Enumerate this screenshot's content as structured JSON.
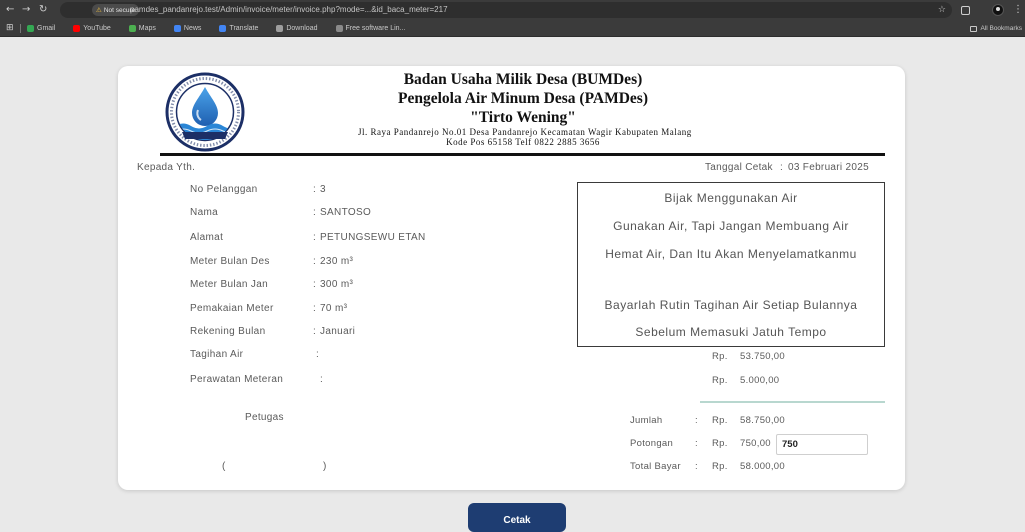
{
  "browser": {
    "security_label": "Not secure",
    "url": "pamdes_pandanrejo.test/Admin/invoice/meter/invoice.php?mode=...&id_baca_meter=217",
    "bookmarks": [
      {
        "label": "Gmail",
        "icon": "gmail-icon",
        "color": "#34a853"
      },
      {
        "label": "YouTube",
        "icon": "youtube-icon",
        "color": "#ff0000"
      },
      {
        "label": "Maps",
        "icon": "maps-icon",
        "color": "#4caf50"
      },
      {
        "label": "News",
        "icon": "news-icon",
        "color": "#4285f4"
      },
      {
        "label": "Translate",
        "icon": "translate-icon",
        "color": "#4285f4"
      },
      {
        "label": "Download",
        "icon": "download-icon",
        "color": "#9e9e9e"
      },
      {
        "label": "Free software Lin...",
        "icon": "page-icon",
        "color": "#8a8a8a"
      }
    ],
    "all_bookmarks_label": "All Bookmarks"
  },
  "header": {
    "line1": "Badan Usaha Milik Desa (BUMDes)",
    "line2": "Pengelola Air Minum Desa (PAMDes)",
    "line3": "\"Tirto Wening\"",
    "address": "Jl. Raya Pandanrejo No.01 Desa Pandanrejo Kecamatan Wagir Kabupaten Malang",
    "contact": "Kode Pos 65158 Telf 0822 2885 3656"
  },
  "receipt": {
    "recipient_label": "Kepada Yth.",
    "print_date_label": "Tanggal Cetak",
    "print_date": "03 Februari 2025",
    "separator": ":",
    "fields": [
      {
        "label": "No Pelanggan",
        "value": "3"
      },
      {
        "label": "Nama",
        "value": "SANTOSO"
      },
      {
        "label": "Alamat",
        "value": "PETUNGSEWU ETAN"
      },
      {
        "label": "Meter Bulan Des",
        "value": "230 m³"
      },
      {
        "label": "Meter Bulan Jan",
        "value": "300 m³"
      },
      {
        "label": "Pemakaian Meter",
        "value": "70 m³"
      },
      {
        "label": "Rekening Bulan",
        "value": "Januari"
      },
      {
        "label": "Tagihan Air"
      },
      {
        "label": "Perawatan Meteran"
      }
    ]
  },
  "message_box": {
    "lines": [
      "Bijak Menggunakan Air",
      "Gunakan Air, Tapi Jangan Membuang Air",
      "Hemat Air, Dan Itu Akan Menyelamatkanmu",
      "Bayarlah Rutin Tagihan Air Setiap Bulannya",
      "Sebelum Memasuki Jatuh Tempo"
    ]
  },
  "billing": {
    "currency": "Rp.",
    "tagihan_air": "53.750,00",
    "perawatan_meteran": "5.000,00",
    "jumlah_label": "Jumlah",
    "jumlah": "58.750,00",
    "potongan_label": "Potongan",
    "potongan": "750,00",
    "potongan_input": "750",
    "total_label": "Total Bayar",
    "total": "58.000,00"
  },
  "signature": {
    "label": "Petugas",
    "open": "(",
    "close": ")"
  },
  "print_button_label": "Cetak",
  "theme": {
    "button_bg": "#1e3d72",
    "divider": "#b8d7cf",
    "logo_navy": "#1c2f66",
    "logo_blue": "#1f6fc0"
  }
}
